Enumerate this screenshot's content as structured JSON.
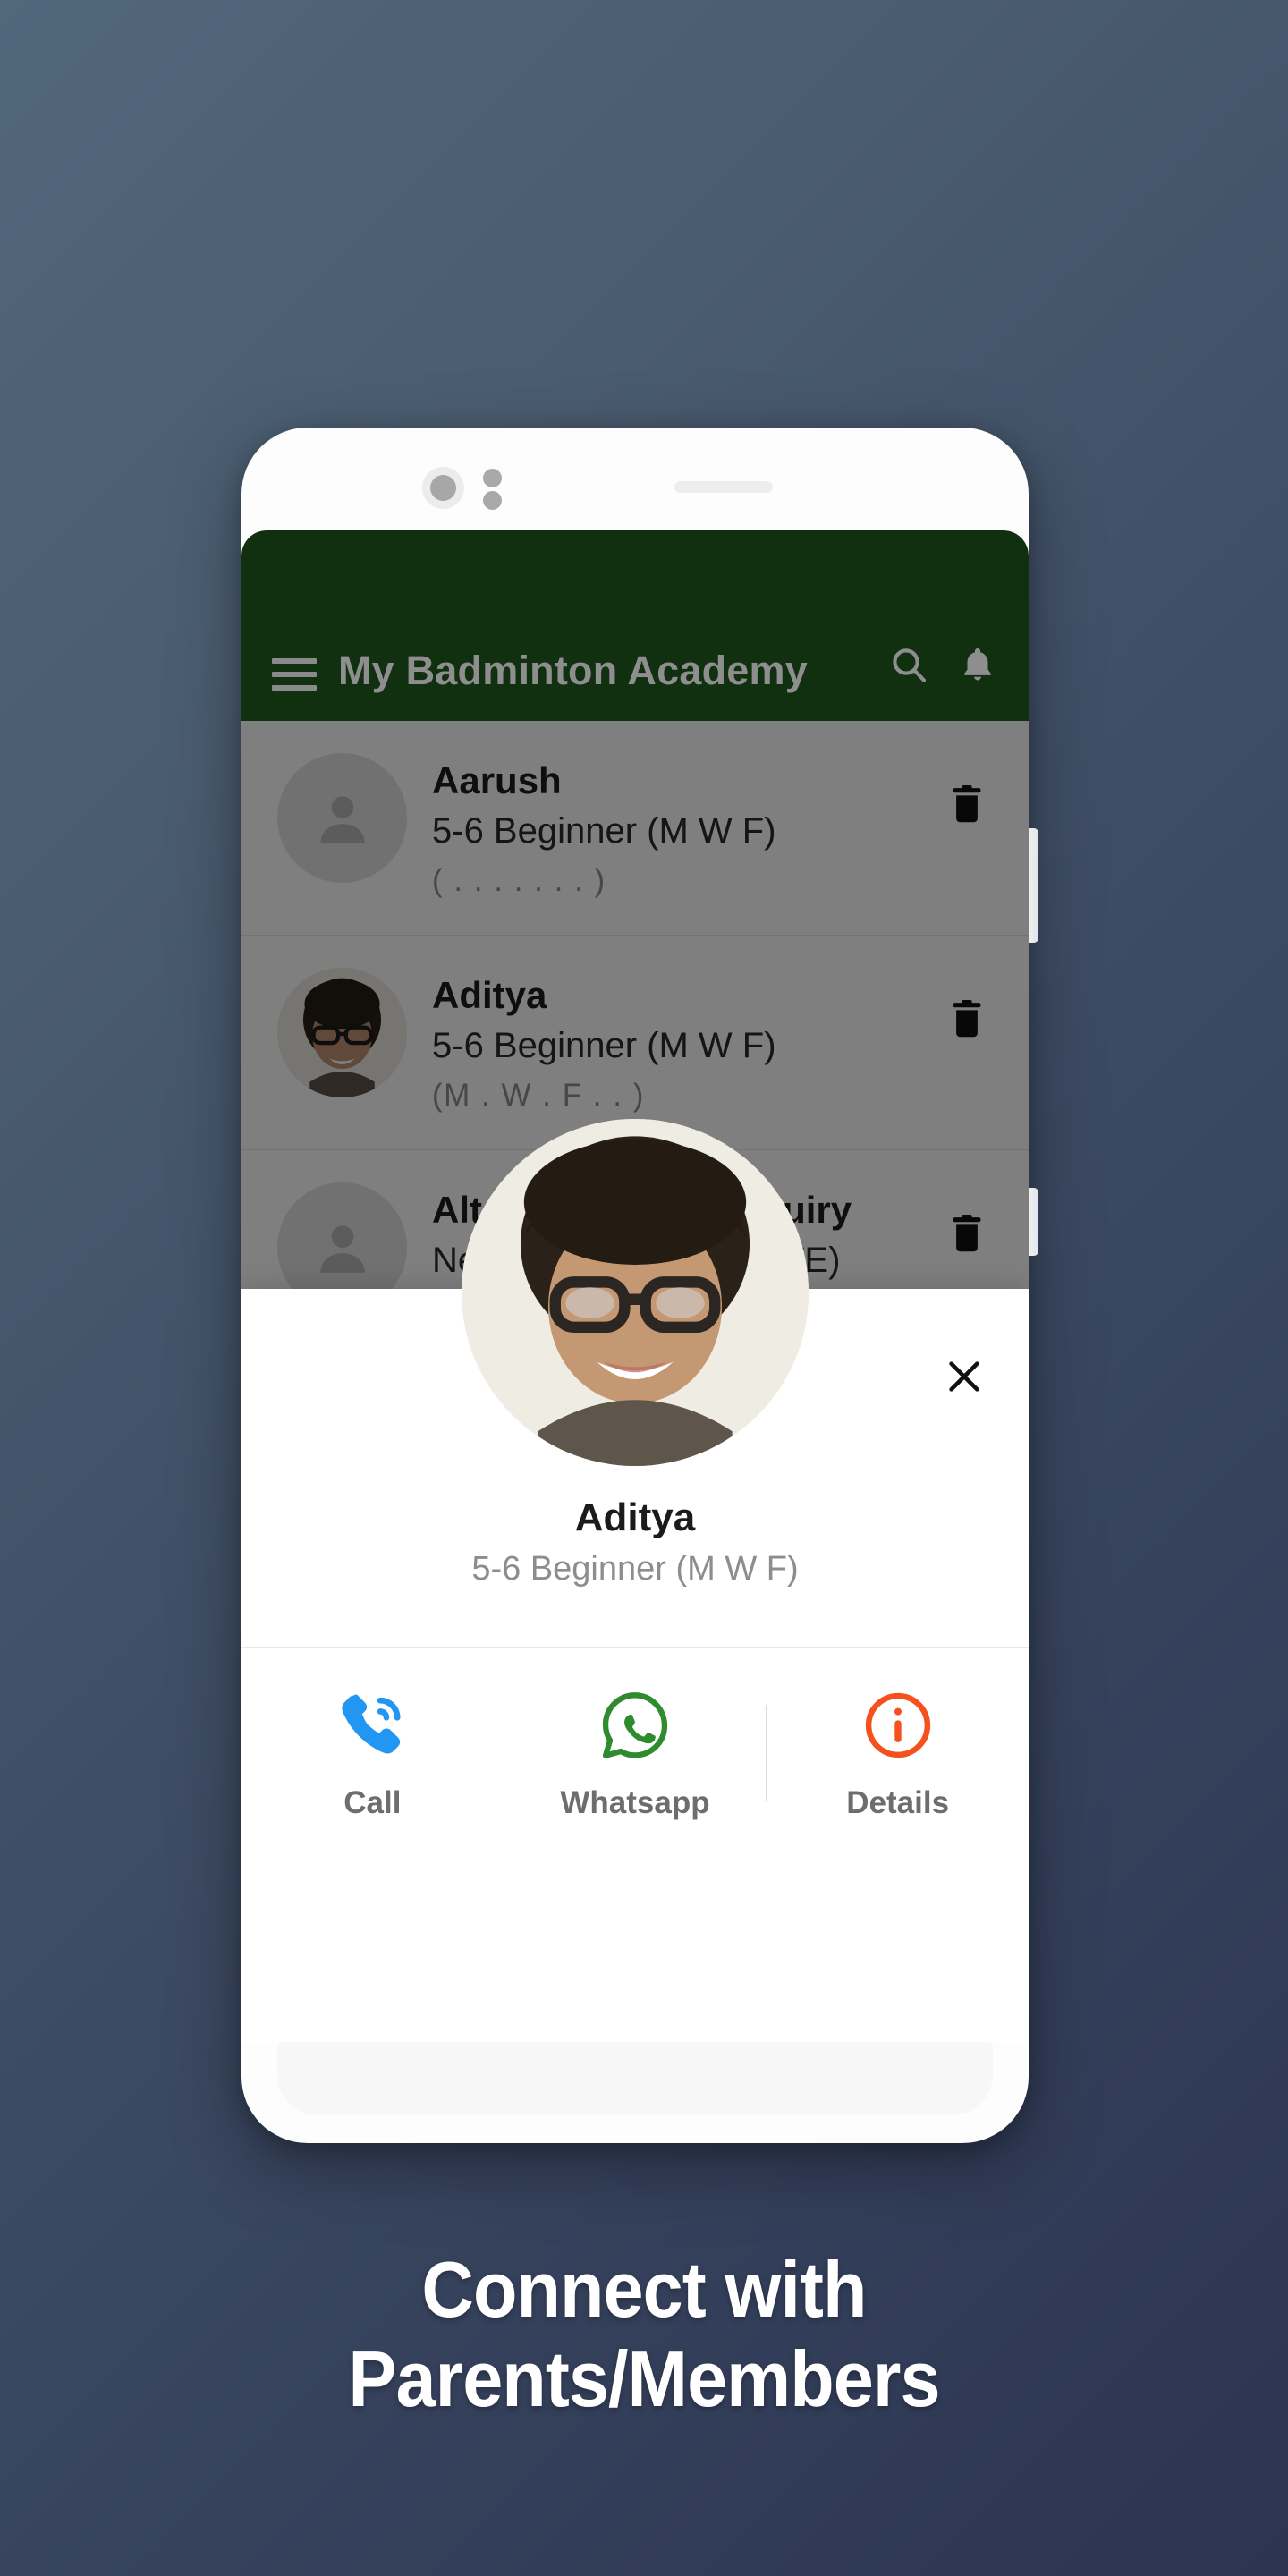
{
  "app": {
    "title": "My Badminton Academy",
    "appbar_color": "#11300f",
    "menu_icon": "hamburger-menu-icon",
    "search_icon": "search-icon",
    "notification_icon": "bell-icon"
  },
  "member_list": {
    "items": [
      {
        "name": "Aarush",
        "batch": "5-6 Beginner (M W F)",
        "days": "( . . . . . . . )",
        "avatar": "person-placeholder",
        "delete_icon": "trash-icon"
      },
      {
        "name": "Aditya",
        "batch": "5-6 Beginner (M W F)",
        "days": "(M . W . F . . )",
        "avatar": "photo",
        "delete_icon": "trash-icon"
      },
      {
        "name": "Alternate batch enquiry",
        "batch": "New batch (ALTERNATE)",
        "days": "( . . . . . . . )",
        "avatar": "person-placeholder",
        "delete_icon": "trash-icon"
      }
    ]
  },
  "contact_sheet": {
    "name": "Aditya",
    "batch": "5-6 Beginner (M W F)",
    "close_icon": "close-icon",
    "avatar": "photo",
    "actions": [
      {
        "label": "Call",
        "icon": "phone-icon",
        "color": "#2196f3"
      },
      {
        "label": "Whatsapp",
        "icon": "whatsapp-icon",
        "color": "#2e8b2e"
      },
      {
        "label": "Details",
        "icon": "info-circle-icon",
        "color": "#f4511e"
      }
    ]
  },
  "caption": {
    "line1": "Connect with",
    "line2": "Parents/Members"
  },
  "colors": {
    "background_top": "#51677a",
    "background_bottom": "#2b3452",
    "appbar_green": "#11300f",
    "scrim": "rgba(0,0,0,0.5)"
  }
}
